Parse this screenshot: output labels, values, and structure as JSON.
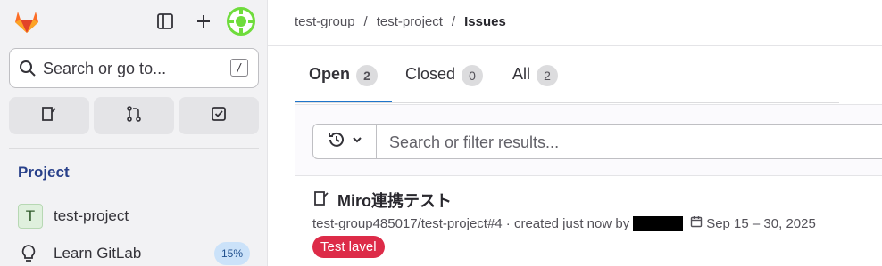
{
  "sidebar": {
    "search_placeholder": "Search or go to...",
    "search_shortcut": "/",
    "section_heading": "Project",
    "project_item": {
      "avatar_letter": "T",
      "label": "test-project"
    },
    "learn_item": {
      "label": "Learn GitLab",
      "badge": "15%"
    },
    "icons": [
      "gitlab-logo",
      "sidebar-toggle-icon",
      "plus-icon",
      "user-avatar",
      "issues-icon",
      "merge-request-icon",
      "todo-icon",
      "lightbulb-icon"
    ]
  },
  "breadcrumb": {
    "items": [
      "test-group",
      "test-project"
    ],
    "current": "Issues",
    "separator": "/"
  },
  "tabs": [
    {
      "label": "Open",
      "count": "2"
    },
    {
      "label": "Closed",
      "count": "0"
    },
    {
      "label": "All",
      "count": "2"
    }
  ],
  "filter": {
    "placeholder": "Search or filter results..."
  },
  "issue": {
    "title": "Miro連携テスト",
    "reference": "test-group485017/test-project#4 · created just now by",
    "date_range": "Sep 15 – 30, 2025",
    "label": "Test lavel",
    "label_color": "#dd2b48"
  },
  "colors": {
    "accent": "#1f75cb",
    "sidebar_bg": "#f2f2f4",
    "heading": "#28408a"
  }
}
